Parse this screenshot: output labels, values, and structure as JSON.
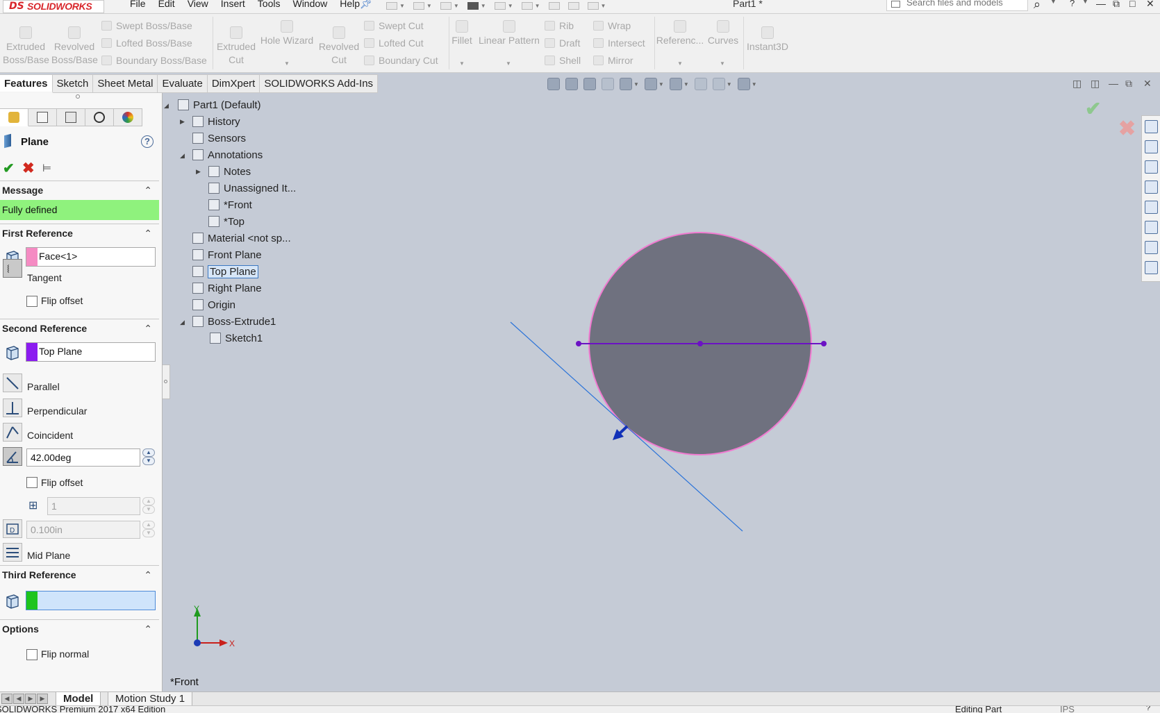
{
  "app": {
    "brand_ds": "DS",
    "brand": "SOLIDWORKS",
    "doc_title": "Part1 *"
  },
  "menu": [
    "File",
    "Edit",
    "View",
    "Insert",
    "Tools",
    "Window",
    "Help"
  ],
  "search": {
    "placeholder": "Search files and models"
  },
  "ribbon": {
    "extruded_boss": "Extruded Boss/Base",
    "revolved_boss": "Revolved Boss/Base",
    "swept_boss": "Swept Boss/Base",
    "lofted_boss": "Lofted Boss/Base",
    "boundary_boss": "Boundary Boss/Base",
    "extruded_cut": "Extruded Cut",
    "hole_wizard": "Hole Wizard",
    "revolved_cut": "Revolved Cut",
    "swept_cut": "Swept Cut",
    "lofted_cut": "Lofted Cut",
    "boundary_cut": "Boundary Cut",
    "fillet": "Fillet",
    "linear_pattern": "Linear Pattern",
    "rib": "Rib",
    "draft": "Draft",
    "shell": "Shell",
    "wrap": "Wrap",
    "intersect": "Intersect",
    "mirror": "Mirror",
    "reference": "Referenc...",
    "curves": "Curves",
    "instant3d": "Instant3D"
  },
  "tabs": [
    "Features",
    "Sketch",
    "Sheet Metal",
    "Evaluate",
    "DimXpert",
    "SOLIDWORKS Add-Ins"
  ],
  "property_manager": {
    "title": "Plane",
    "help": "?",
    "message_header": "Message",
    "message": "Fully defined",
    "first_ref": {
      "header": "First Reference",
      "selection": "Face<1>",
      "swatch": "#f58bc3",
      "tangent": "Tangent",
      "flip_offset": "Flip offset"
    },
    "second_ref": {
      "header": "Second Reference",
      "selection": "Top Plane",
      "swatch": "#8b1cf0",
      "parallel": "Parallel",
      "perpendicular": "Perpendicular",
      "coincident": "Coincident",
      "angle": "42.00deg",
      "flip_offset": "Flip offset",
      "instances": "1",
      "distance": "0.100in",
      "mid_plane": "Mid Plane"
    },
    "third_ref": {
      "header": "Third Reference",
      "selection": "",
      "swatch": "#1ec41e"
    },
    "options": {
      "header": "Options",
      "flip_normal": "Flip normal"
    }
  },
  "tree": {
    "root": "Part1  (Default)",
    "history": "History",
    "sensors": "Sensors",
    "annotations": "Annotations",
    "notes": "Notes",
    "unassigned": "Unassigned It...",
    "front_note": "*Front",
    "top_note": "*Top",
    "material": "Material <not sp...",
    "front_plane": "Front Plane",
    "top_plane": "Top Plane",
    "right_plane": "Right Plane",
    "origin": "Origin",
    "boss_extrude": "Boss-Extrude1",
    "sketch": "Sketch1"
  },
  "graphics": {
    "view_label": "*Front",
    "axis_x": "X",
    "axis_y": "Y"
  },
  "bottom_tabs": [
    "Model",
    "Motion Study 1"
  ],
  "status": {
    "left": "SOLIDWORKS Premium 2017 x64 Edition",
    "right": "Editing Part",
    "units": "IPS"
  }
}
